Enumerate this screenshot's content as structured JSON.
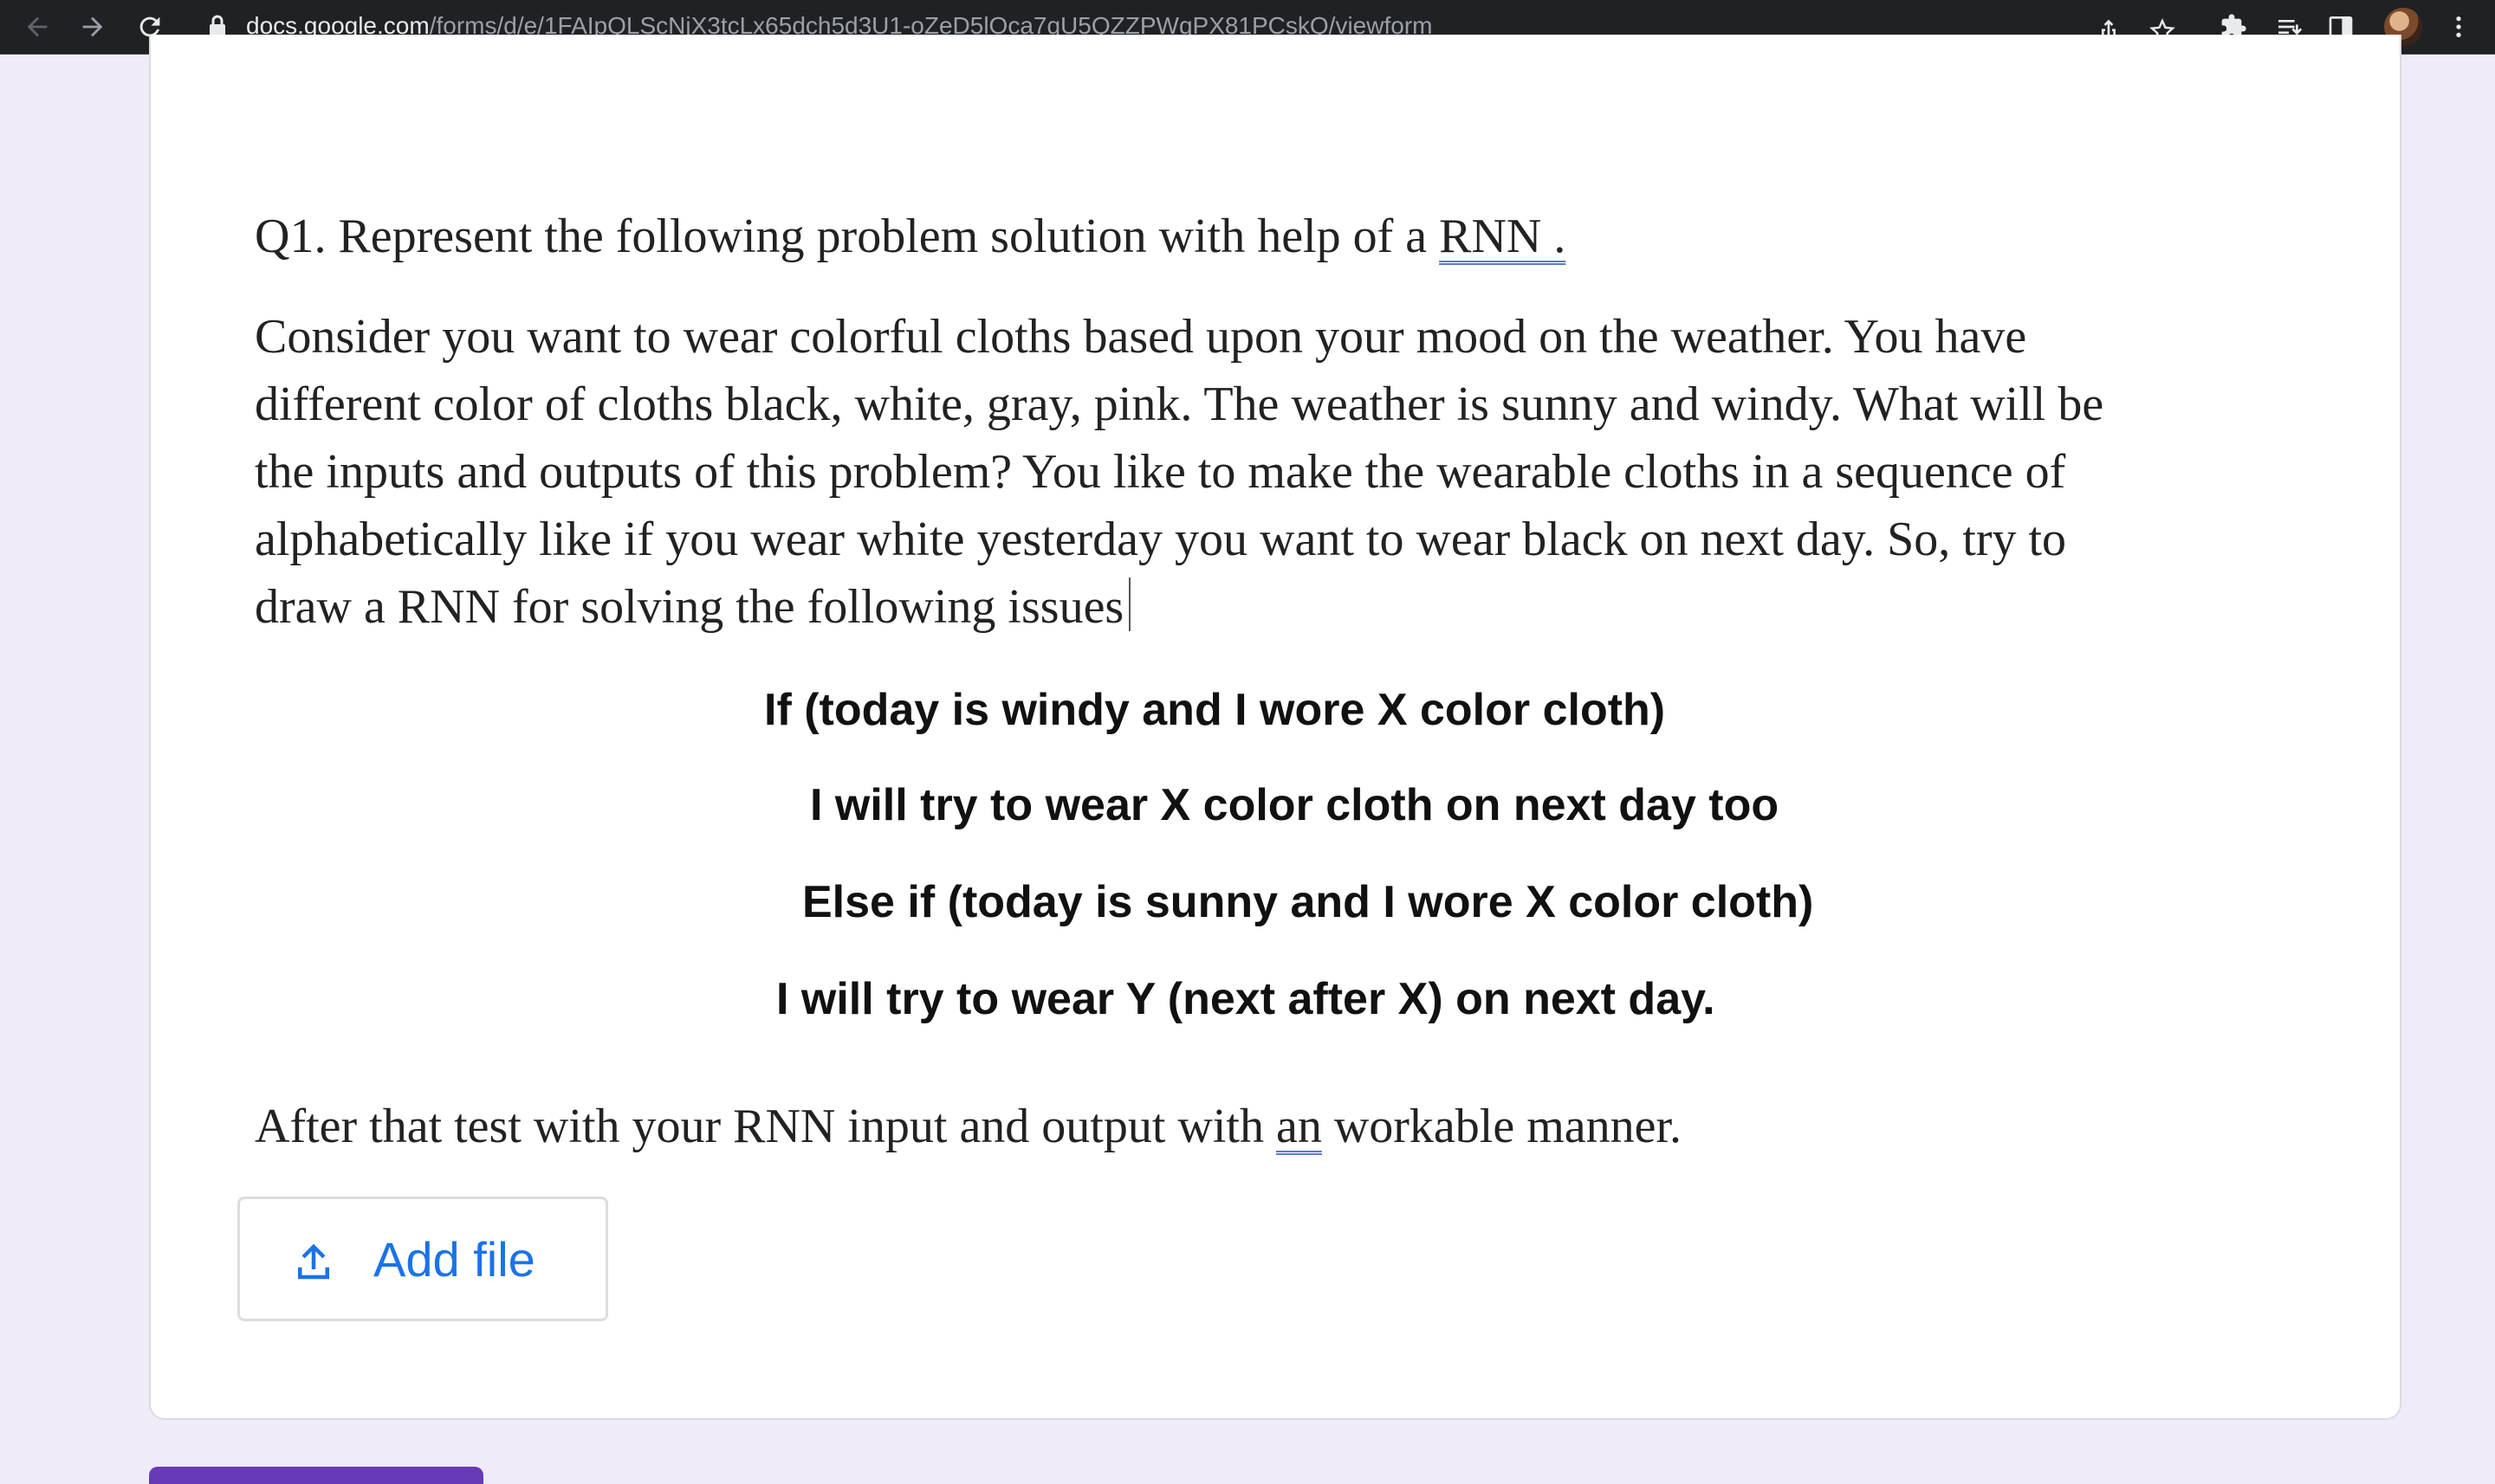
{
  "browser": {
    "url_host": "docs.google.com",
    "url_path": "/forms/d/e/1FAIpQLScNjX3tcLx65dch5d3U1-oZeD5lOca7qU5QZZPWqPX81PCskQ/viewform",
    "icons": [
      "back-icon",
      "forward-icon",
      "reload-icon",
      "lock-icon",
      "share-icon",
      "star-icon",
      "extensions-icon",
      "reading-list-icon",
      "side-panel-icon",
      "avatar",
      "more-icon"
    ]
  },
  "question": {
    "title_prefix": "Q1. Represent the following problem solution with help of a ",
    "title_link": "RNN .",
    "paragraph_lines": [
      "Consider you want to wear colorful cloths based upon your mood on the weather. You have",
      "different color of cloths black, white, gray, pink. The weather is sunny and windy.  What will be",
      "the inputs and outputs of this problem? You like to make the wearable cloths in a sequence of",
      "alphabetically like if you wear white yesterday you want to wear black on next day. So, try to",
      "draw a RNN for solving the following issues"
    ],
    "rules": [
      "If (today is windy and I wore X color cloth)",
      "I will try to wear X color cloth on next day too",
      "Else if (today is sunny and I wore X color cloth)",
      "I will try to wear Y (next after X) on next day."
    ],
    "footer_prefix": "After that test with your RNN input and output with ",
    "footer_underlined": "an",
    "footer_suffix": " workable manner."
  },
  "upload": {
    "button_label": "Add file"
  },
  "colors": {
    "page_bg": "#f0ebf8",
    "accent": "#673ab7",
    "link_blue": "#1a73e8"
  }
}
